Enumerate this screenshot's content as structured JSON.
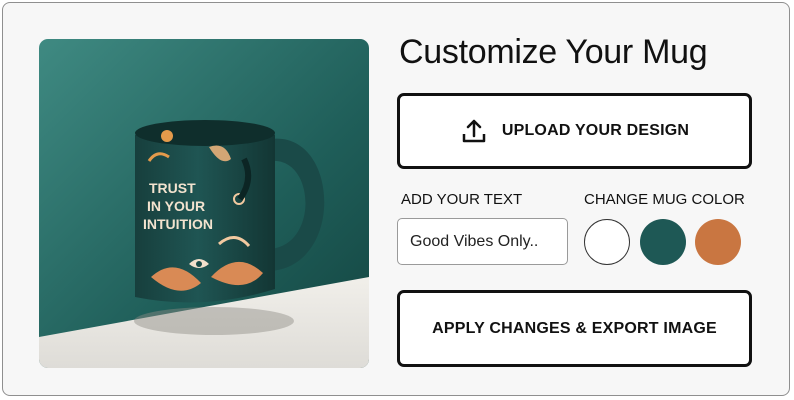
{
  "header": {
    "title": "Customize Your Mug"
  },
  "preview": {
    "mug_print_lines": [
      "TRUST",
      "IN YOUR",
      "INTUITION"
    ]
  },
  "upload": {
    "label": "UPLOAD YOUR DESIGN",
    "icon": "upload-icon"
  },
  "text_section": {
    "label": "ADD YOUR TEXT",
    "input_value": "Good Vibes Only.."
  },
  "color_section": {
    "label": "CHANGE MUG COLOR",
    "swatches": [
      {
        "name": "white",
        "color": "#ffffff"
      },
      {
        "name": "teal",
        "color": "#1e5855"
      },
      {
        "name": "orange",
        "color": "#c97641"
      }
    ]
  },
  "export": {
    "label": "APPLY CHANGES & EXPORT IMAGE"
  }
}
